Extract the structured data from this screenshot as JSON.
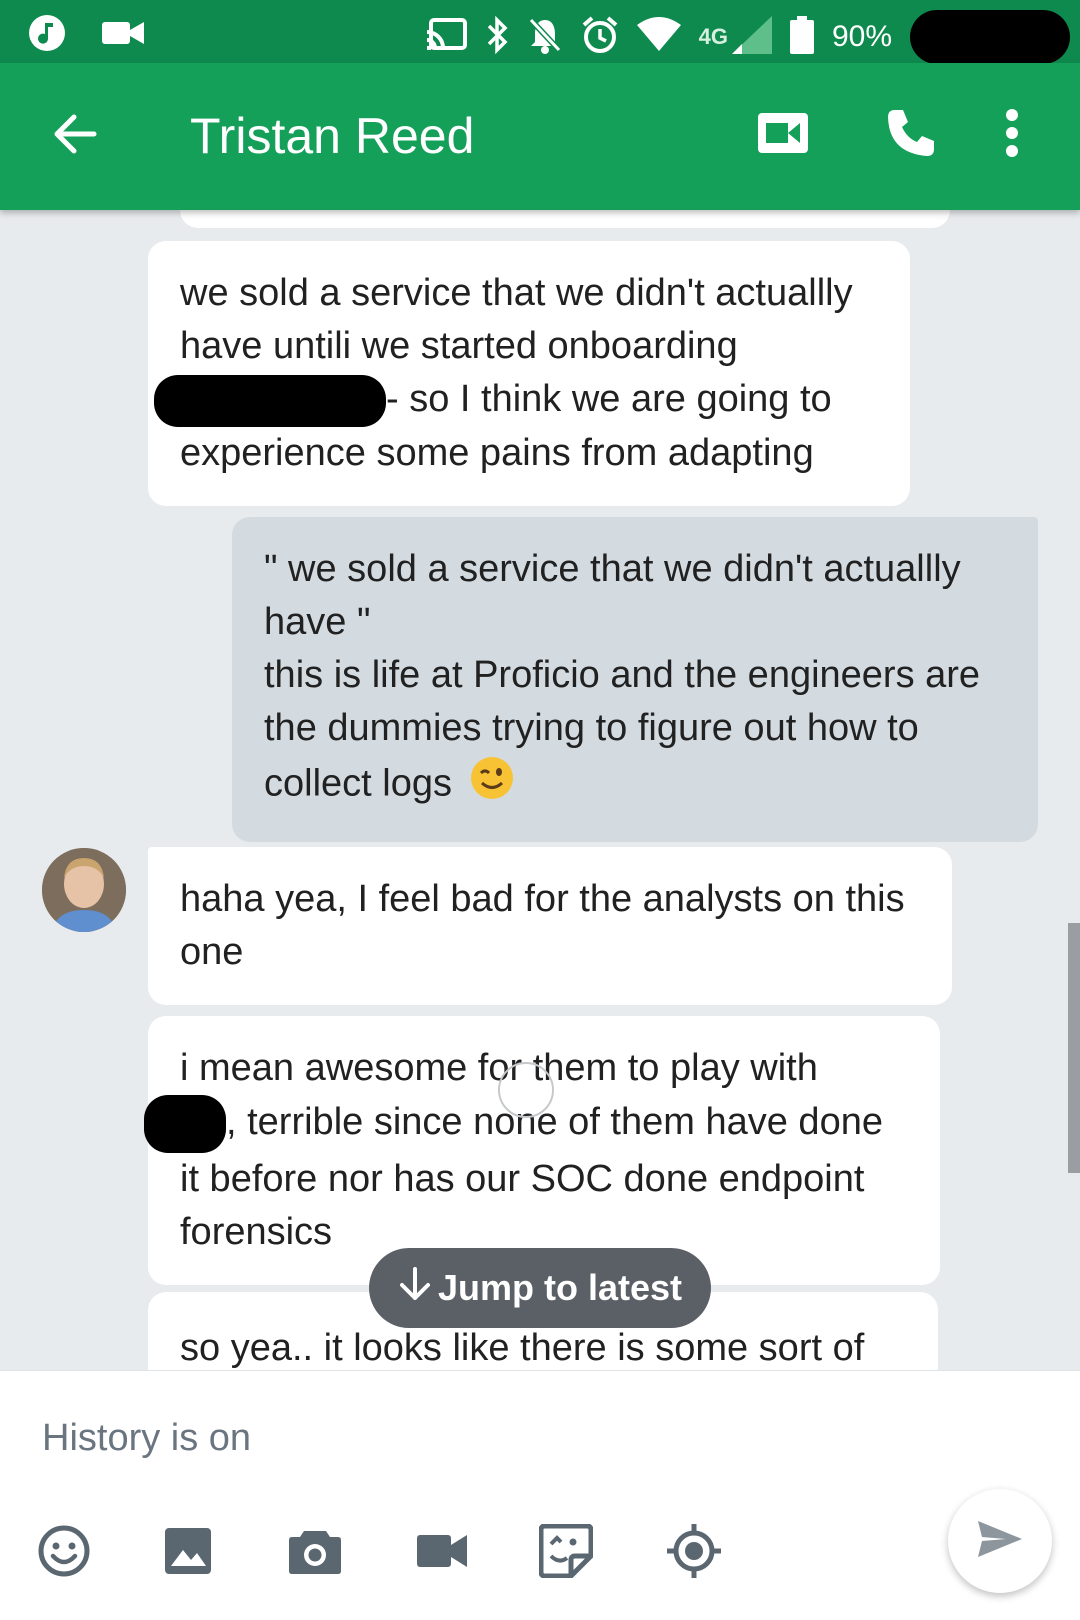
{
  "status_bar": {
    "network": "4G",
    "battery_percent": "90%"
  },
  "header": {
    "contact_name": "Tristan Reed"
  },
  "messages": [
    {
      "line1": "we sold a service that we didn't actuallly",
      "line2": "have untili we started onboarding",
      "line3": "- so I think we are going to",
      "line4": "experience some pains from adapting"
    },
    {
      "line1": "\" we sold a service that we didn't actuallly",
      "line2": "have \"",
      "line3": "this is life at Proficio and the engineers are",
      "line4": "the dummies trying to figure out how to",
      "line5": "collect logs"
    },
    {
      "line1": "haha yea, I feel bad for the analysts on this",
      "line2": "one"
    },
    {
      "line1": "i mean awesome for them to play with",
      "line2": ", terrible since none of them have done",
      "line3": "it before nor has our SOC done endpoint",
      "line4": "forensics"
    },
    {
      "line1": "so yea.. it looks like there is some sort of"
    }
  ],
  "jump_button": {
    "label": "Jump to latest"
  },
  "composer": {
    "placeholder": "History is on"
  }
}
